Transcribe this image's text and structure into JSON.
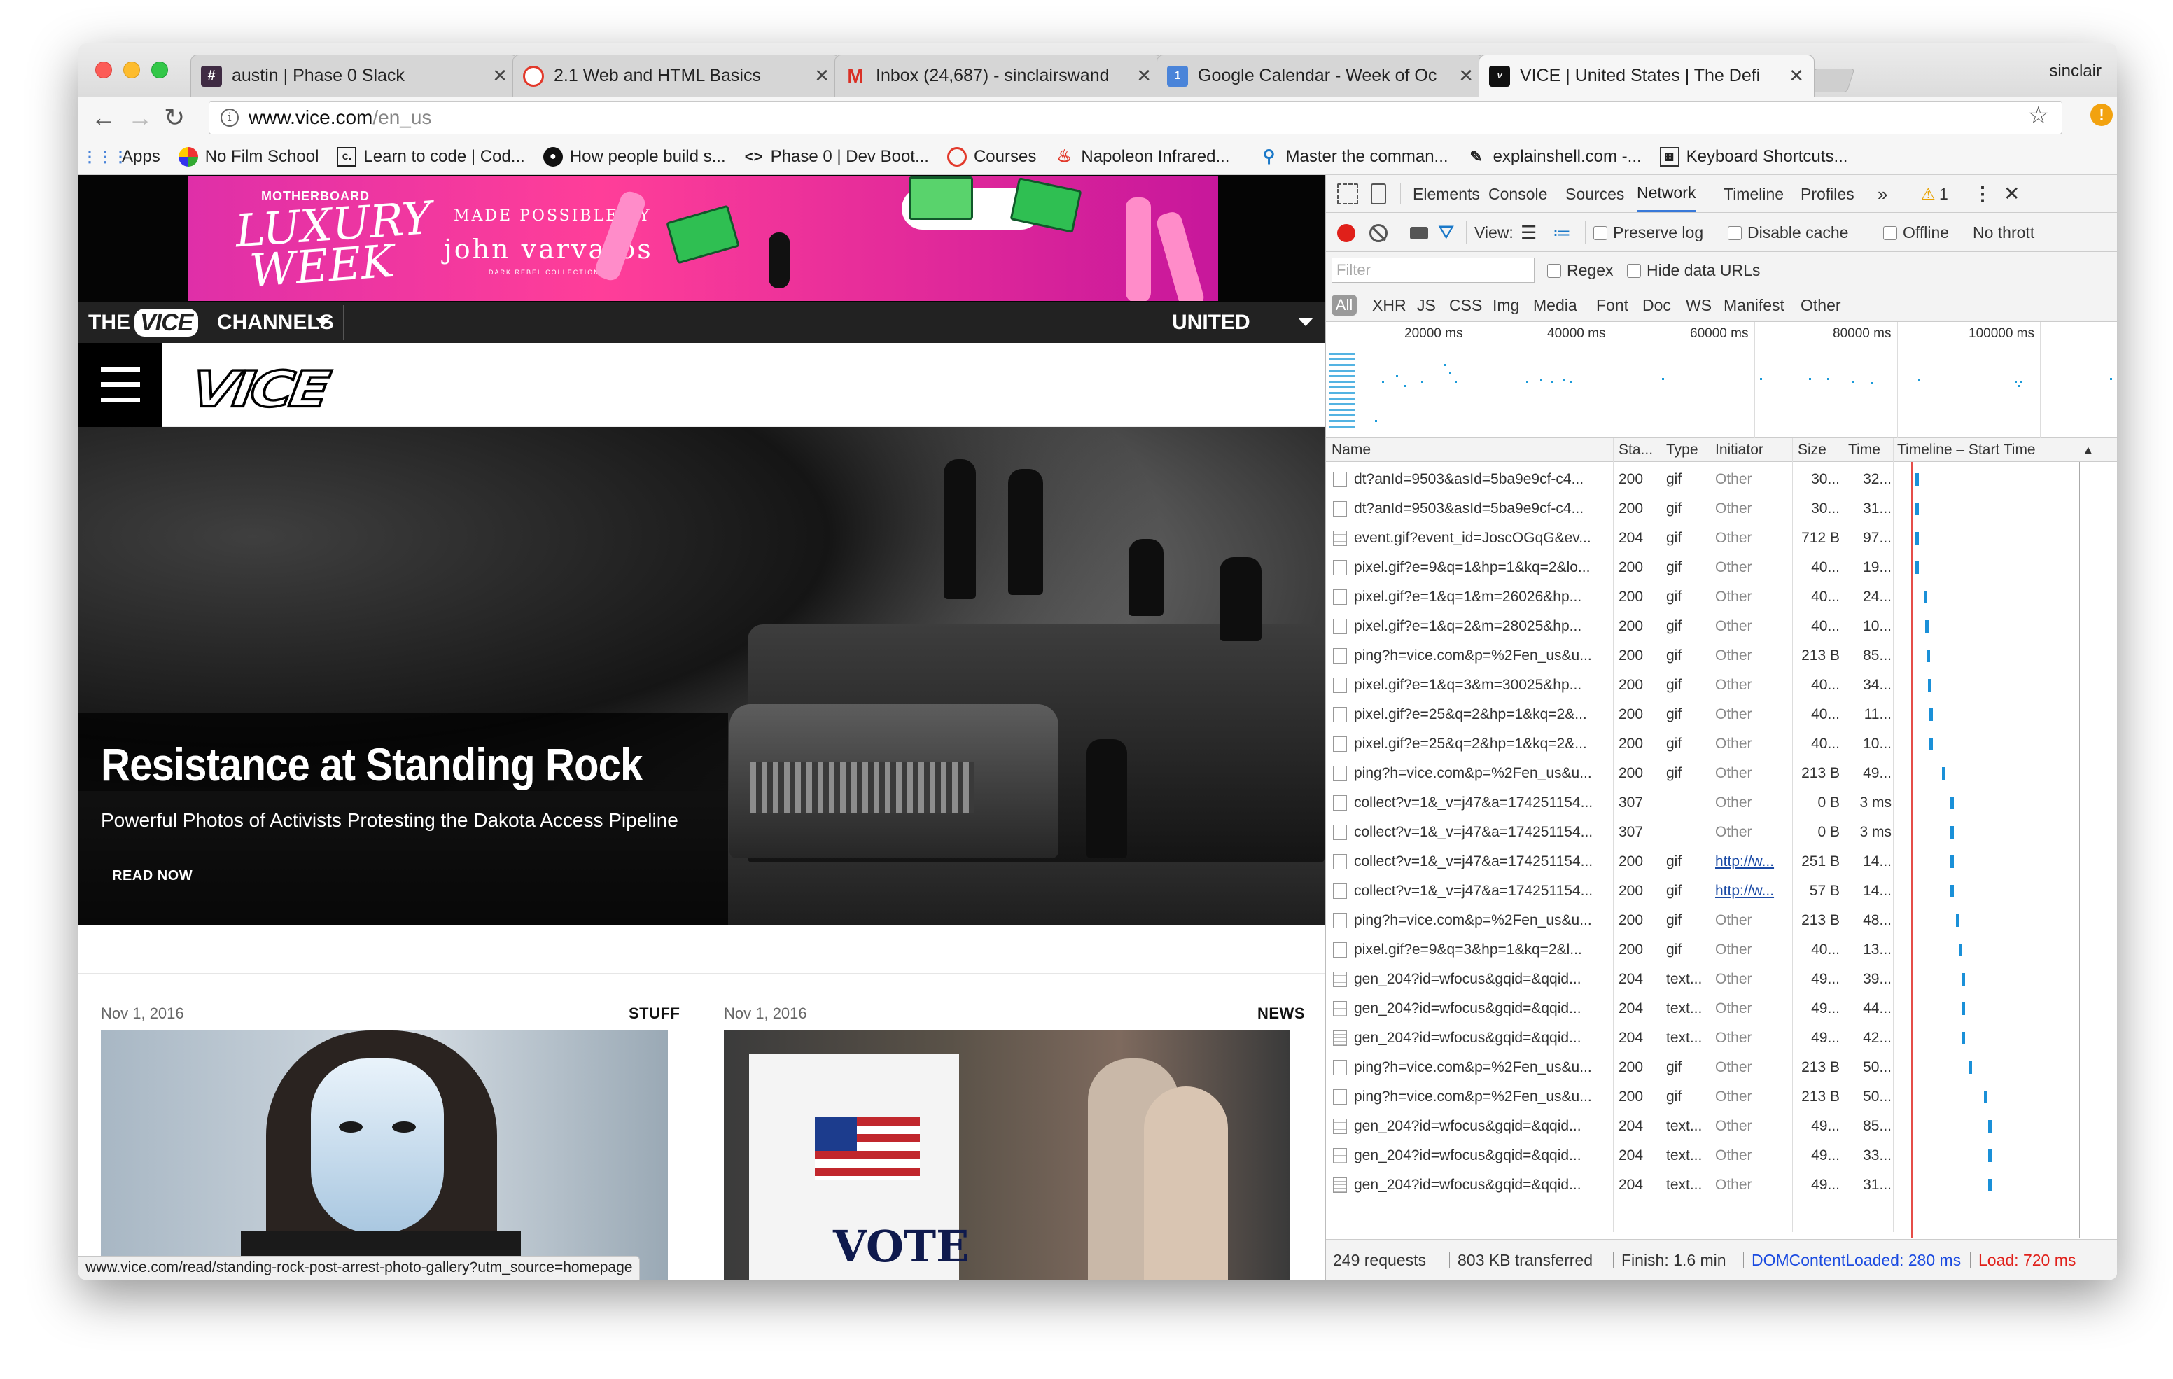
{
  "browser": {
    "user": "sinclair",
    "tabs": [
      {
        "title": "austin | Phase 0 Slack",
        "icon": "slack-hash-icon"
      },
      {
        "title": "2.1 Web and HTML Basics",
        "icon": "devbootcamp-icon"
      },
      {
        "title": "Inbox (24,687) - sinclairswand",
        "icon": "gmail-icon"
      },
      {
        "title": "Google Calendar - Week of Oc",
        "icon": "calendar-icon"
      },
      {
        "title": "VICE | United States | The Defi",
        "icon": "vice-icon",
        "active": true
      }
    ],
    "url_host": "www.vice.com",
    "url_path": "/en_us",
    "bookmarks": [
      {
        "label": "Apps",
        "icon": "apps-grid-icon"
      },
      {
        "label": "No Film School",
        "icon": "globe-icon"
      },
      {
        "label": "Learn to code | Cod...",
        "icon": "codecademy-icon"
      },
      {
        "label": "How people build s...",
        "icon": "github-icon"
      },
      {
        "label": "Phase 0 | Dev Boot...",
        "icon": "code-brackets-icon"
      },
      {
        "label": "Courses",
        "icon": "devbootcamp-icon"
      },
      {
        "label": "Napoleon Infrared...",
        "icon": "flame-icon"
      },
      {
        "label": "Master the comman...",
        "icon": "pin-icon"
      },
      {
        "label": "explainshell.com -...",
        "icon": "shell-icon"
      },
      {
        "label": "Keyboard Shortcuts...",
        "icon": "keyboard-icon"
      }
    ]
  },
  "page": {
    "ad": {
      "brand": "MOTHERBOARD",
      "headline": "LUXURY WEEK",
      "made_possible": "MADE POSSIBLE BY",
      "sponsor": "john varvatos",
      "collection": "DARK REBEL COLLECTION"
    },
    "channel_bar": {
      "the": "THE",
      "logo": "VICE",
      "channels": "CHANNELS",
      "region": "UNITED STATES"
    },
    "logo": "VICE",
    "hero": {
      "title": "Resistance at Standing Rock",
      "subtitle": "Powerful Photos of Activists Protesting the Dakota Access Pipeline",
      "cta": "READ NOW"
    },
    "cards": [
      {
        "date": "Nov 1, 2016",
        "category": "STUFF"
      },
      {
        "date": "Nov 1, 2016",
        "category": "NEWS",
        "sign_text": "VOTE"
      }
    ],
    "status_url": "www.vice.com/read/standing-rock-post-arrest-photo-gallery?utm_source=homepage"
  },
  "devtools": {
    "tabs": [
      "Elements",
      "Console",
      "Sources",
      "Network",
      "Timeline",
      "Profiles"
    ],
    "selected_tab": "Network",
    "more": "»",
    "warnings": "1",
    "toolbar": {
      "view_label": "View:",
      "preserve_log": "Preserve log",
      "disable_cache": "Disable cache",
      "offline": "Offline",
      "throttle": "No thrott"
    },
    "filter_placeholder": "Filter",
    "regex": "Regex",
    "hide_data_urls": "Hide data URLs",
    "types": [
      "All",
      "XHR",
      "JS",
      "CSS",
      "Img",
      "Media",
      "Font",
      "Doc",
      "WS",
      "Manifest",
      "Other"
    ],
    "overview_ticks": [
      "20000 ms",
      "40000 ms",
      "60000 ms",
      "80000 ms",
      "100000 ms"
    ],
    "columns": [
      "Name",
      "Sta...",
      "Type",
      "Initiator",
      "Size",
      "Time",
      "Timeline – Start Time"
    ],
    "rows": [
      {
        "name": "dt?anId=9503&asId=5ba9e9cf-c4...",
        "status": "200",
        "type": "gif",
        "initiator": "Other",
        "size": "30...",
        "time": "32..."
      },
      {
        "name": "dt?anId=9503&asId=5ba9e9cf-c4...",
        "status": "200",
        "type": "gif",
        "initiator": "Other",
        "size": "30...",
        "time": "31..."
      },
      {
        "name": "event.gif?event_id=JoscOGqG&ev...",
        "status": "204",
        "type": "gif",
        "initiator": "Other",
        "size": "712 B",
        "time": "97..."
      },
      {
        "name": "pixel.gif?e=9&q=1&hp=1&kq=2&lo...",
        "status": "200",
        "type": "gif",
        "initiator": "Other",
        "size": "40...",
        "time": "19..."
      },
      {
        "name": "pixel.gif?e=1&q=1&m=26026&hp...",
        "status": "200",
        "type": "gif",
        "initiator": "Other",
        "size": "40...",
        "time": "24..."
      },
      {
        "name": "pixel.gif?e=1&q=2&m=28025&hp...",
        "status": "200",
        "type": "gif",
        "initiator": "Other",
        "size": "40...",
        "time": "10..."
      },
      {
        "name": "ping?h=vice.com&p=%2Fen_us&u...",
        "status": "200",
        "type": "gif",
        "initiator": "Other",
        "size": "213 B",
        "time": "85..."
      },
      {
        "name": "pixel.gif?e=1&q=3&m=30025&hp...",
        "status": "200",
        "type": "gif",
        "initiator": "Other",
        "size": "40...",
        "time": "34..."
      },
      {
        "name": "pixel.gif?e=25&q=2&hp=1&kq=2&...",
        "status": "200",
        "type": "gif",
        "initiator": "Other",
        "size": "40...",
        "time": "11..."
      },
      {
        "name": "pixel.gif?e=25&q=2&hp=1&kq=2&...",
        "status": "200",
        "type": "gif",
        "initiator": "Other",
        "size": "40...",
        "time": "10..."
      },
      {
        "name": "ping?h=vice.com&p=%2Fen_us&u...",
        "status": "200",
        "type": "gif",
        "initiator": "Other",
        "size": "213 B",
        "time": "49..."
      },
      {
        "name": "collect?v=1&_v=j47&a=174251154...",
        "status": "307",
        "type": "",
        "initiator": "Other",
        "size": "0 B",
        "time": "3 ms"
      },
      {
        "name": "collect?v=1&_v=j47&a=174251154...",
        "status": "307",
        "type": "",
        "initiator": "Other",
        "size": "0 B",
        "time": "3 ms"
      },
      {
        "name": "collect?v=1&_v=j47&a=174251154...",
        "status": "200",
        "type": "gif",
        "initiator": "http://w...",
        "size": "251 B",
        "time": "14..."
      },
      {
        "name": "collect?v=1&_v=j47&a=174251154...",
        "status": "200",
        "type": "gif",
        "initiator": "http://w...",
        "size": "57 B",
        "time": "14..."
      },
      {
        "name": "ping?h=vice.com&p=%2Fen_us&u...",
        "status": "200",
        "type": "gif",
        "initiator": "Other",
        "size": "213 B",
        "time": "48..."
      },
      {
        "name": "pixel.gif?e=9&q=3&hp=1&kq=2&l...",
        "status": "200",
        "type": "gif",
        "initiator": "Other",
        "size": "40...",
        "time": "13..."
      },
      {
        "name": "gen_204?id=wfocus&gqid=&qqid...",
        "status": "204",
        "type": "text...",
        "initiator": "Other",
        "size": "49...",
        "time": "39..."
      },
      {
        "name": "gen_204?id=wfocus&gqid=&qqid...",
        "status": "204",
        "type": "text...",
        "initiator": "Other",
        "size": "49...",
        "time": "44..."
      },
      {
        "name": "gen_204?id=wfocus&gqid=&qqid...",
        "status": "204",
        "type": "text...",
        "initiator": "Other",
        "size": "49...",
        "time": "42..."
      },
      {
        "name": "ping?h=vice.com&p=%2Fen_us&u...",
        "status": "200",
        "type": "gif",
        "initiator": "Other",
        "size": "213 B",
        "time": "50..."
      },
      {
        "name": "ping?h=vice.com&p=%2Fen_us&u...",
        "status": "200",
        "type": "gif",
        "initiator": "Other",
        "size": "213 B",
        "time": "50..."
      },
      {
        "name": "gen_204?id=wfocus&gqid=&qqid...",
        "status": "204",
        "type": "text...",
        "initiator": "Other",
        "size": "49...",
        "time": "85..."
      },
      {
        "name": "gen_204?id=wfocus&gqid=&qqid...",
        "status": "204",
        "type": "text...",
        "initiator": "Other",
        "size": "49...",
        "time": "33..."
      },
      {
        "name": "gen_204?id=wfocus&gqid=&qqid...",
        "status": "204",
        "type": "text...",
        "initiator": "Other",
        "size": "49...",
        "time": "31..."
      }
    ],
    "summary": {
      "requests": "249 requests",
      "transferred": "803 KB transferred",
      "finish": "Finish: 1.6 min",
      "dom_loaded": "DOMContentLoaded: 280 ms",
      "load": "Load: 720 ms"
    },
    "colors": {
      "dom_loaded": "#1a4ae0",
      "load": "#e0201a",
      "bar": "#1a90d8",
      "selected_tab": "#3879d9"
    }
  }
}
